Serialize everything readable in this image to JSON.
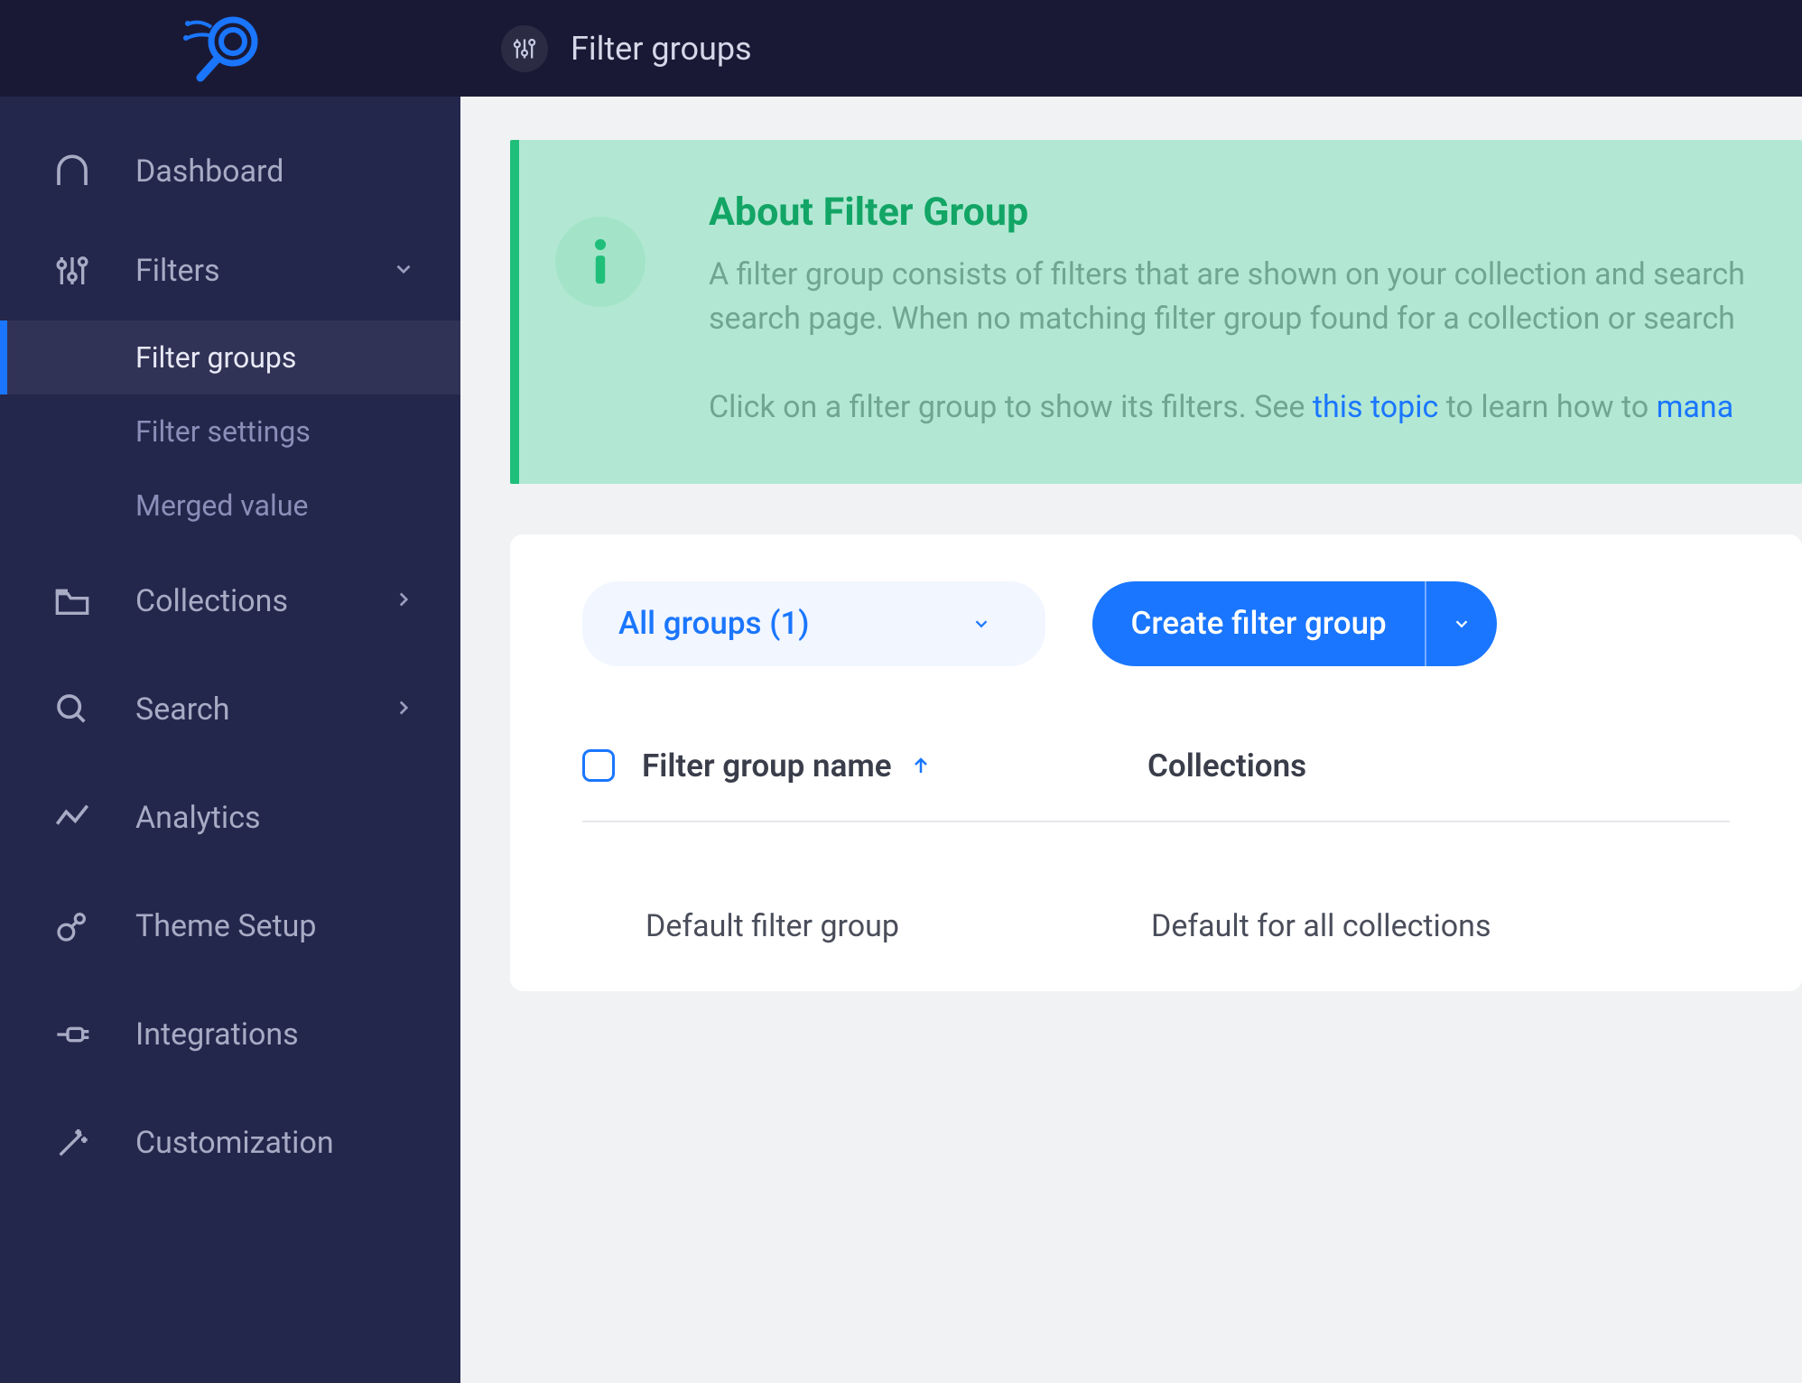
{
  "header": {
    "title": "Filter groups"
  },
  "sidebar": {
    "items": [
      {
        "label": "Dashboard"
      },
      {
        "label": "Filters"
      },
      {
        "label": "Collections"
      },
      {
        "label": "Search"
      },
      {
        "label": "Analytics"
      },
      {
        "label": "Theme Setup"
      },
      {
        "label": "Integrations"
      },
      {
        "label": "Customization"
      }
    ],
    "filters_sub": [
      {
        "label": "Filter groups"
      },
      {
        "label": "Filter settings"
      },
      {
        "label": "Merged value"
      }
    ]
  },
  "info": {
    "title": "About Filter Group",
    "line1": "A filter group consists of filters that are shown on your collection and search",
    "line2": "search page. When no matching filter group found for a collection or search",
    "line3a": "Click on a filter group to show its filters. See ",
    "link1": "this topic",
    "line3b": " to learn how to ",
    "link2": "mana"
  },
  "controls": {
    "dropdown_label": "All groups (1)",
    "create_label": "Create filter group"
  },
  "table": {
    "col1": "Filter group name",
    "col2": "Collections",
    "rows": [
      {
        "name": "Default filter group",
        "collections": "Default for all collections"
      }
    ]
  }
}
